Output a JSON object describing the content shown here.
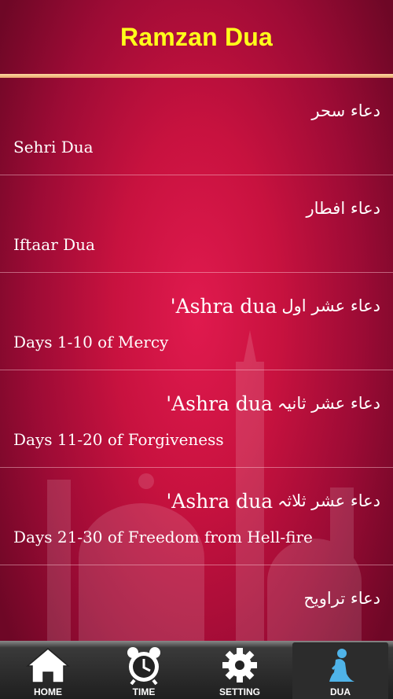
{
  "header": {
    "title": "Ramzan Dua"
  },
  "items": [
    {
      "urdu": "دعاء سحر",
      "ashra": "",
      "english": "Sehri Dua"
    },
    {
      "urdu": "دعاء افطار",
      "ashra": "",
      "english": "Iftaar Dua"
    },
    {
      "urdu": "دعاء عشر اول",
      "ashra": "'Ashra dua",
      "english": "Days 1-10 of Mercy"
    },
    {
      "urdu": "دعاء عشر ثانیہ",
      "ashra": "'Ashra dua",
      "english": "Days 11-20 of Forgiveness"
    },
    {
      "urdu": "دعاء عشر ثلاثہ",
      "ashra": "'Ashra dua",
      "english": "Days 21-30 of Freedom from Hell-fire"
    },
    {
      "urdu": "دعاء تراویح",
      "ashra": "",
      "english": ""
    }
  ],
  "tabs": [
    {
      "label": "HOME",
      "icon": "home-icon"
    },
    {
      "label": "TIME",
      "icon": "clock-icon"
    },
    {
      "label": "SETTING",
      "icon": "gear-icon"
    },
    {
      "label": "DUA",
      "icon": "praying-person-icon"
    }
  ],
  "colors": {
    "title": "#ffff1a",
    "background": "#c8123f",
    "tabbar": "#1f1f1f"
  }
}
